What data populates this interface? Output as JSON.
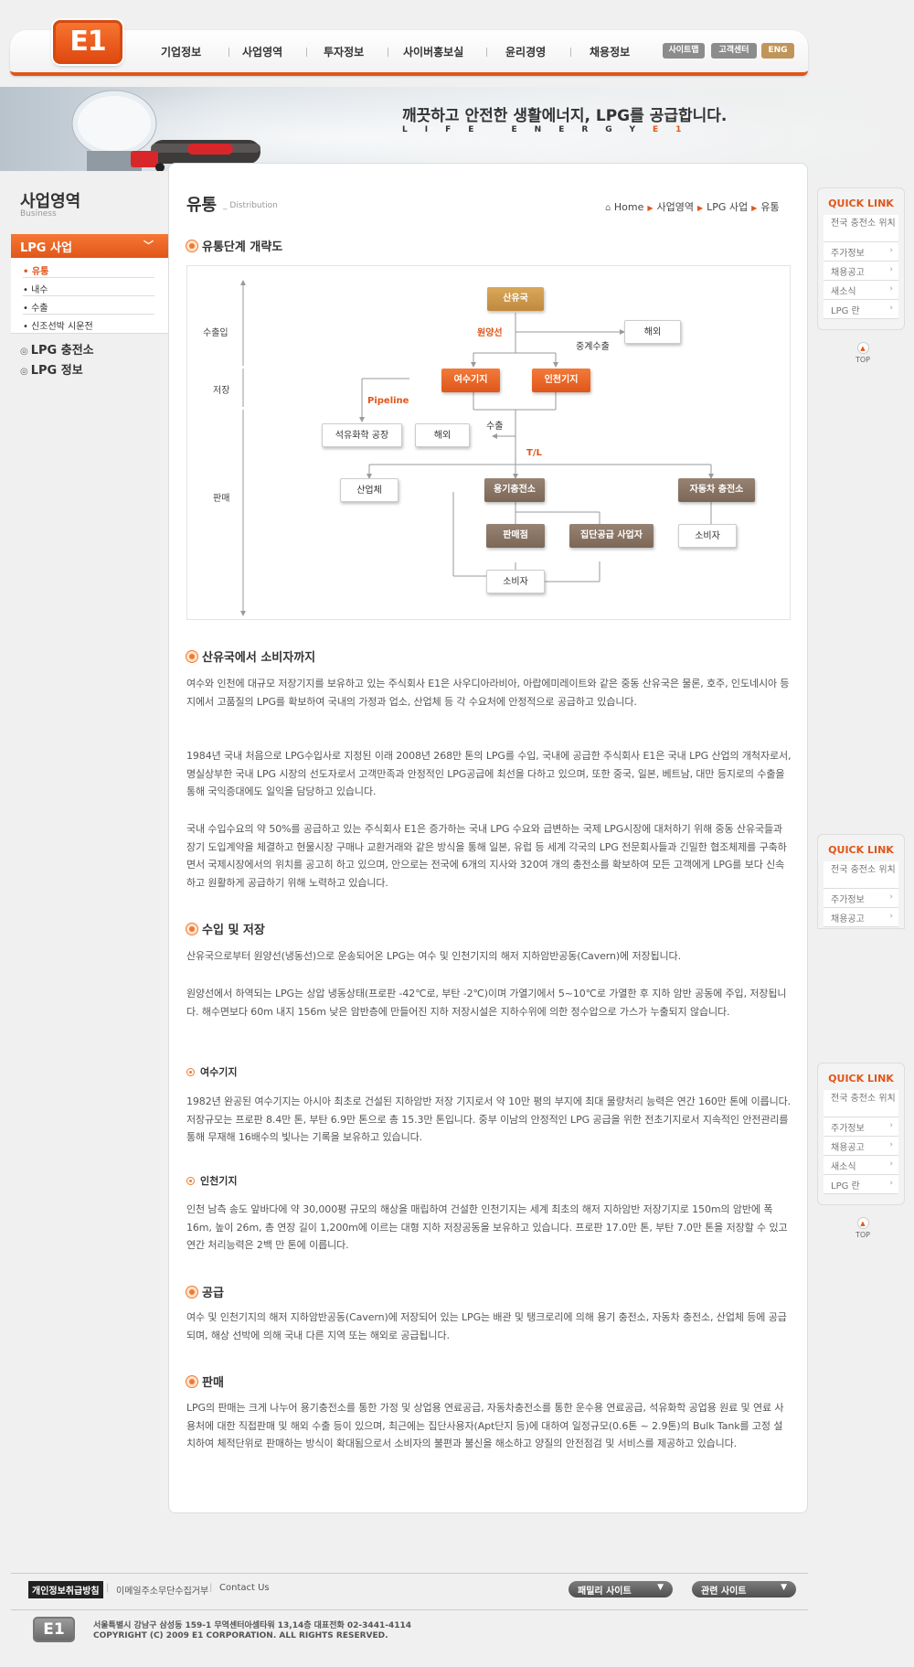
{
  "brand": {
    "logo": "E1",
    "accent": "#e0561a"
  },
  "gnb": {
    "items": [
      "기업정보",
      "사업영역",
      "투자정보",
      "사이버홍보실",
      "윤리경영",
      "채용정보"
    ],
    "util": [
      "사이트맵",
      "고객센터",
      "ENG"
    ]
  },
  "visual": {
    "slogan": "깨끗하고 안전한 생활에너지, LPG를 공급합니다.",
    "sub": "LIFE ENERGY",
    "sub_brand": "E1"
  },
  "lnb": {
    "title": "사업영역",
    "subtitle": "Business",
    "active": "LPG 사업",
    "chevron": "chevron-down-icon",
    "sub_items": [
      "유통",
      "내수",
      "수출",
      "신조선박 시운전"
    ],
    "main_items": [
      "LPG 충전소",
      "LPG 정보"
    ]
  },
  "page": {
    "title": "유통",
    "title_en": "_ Distribution",
    "breadcrumb": [
      "Home",
      "사업영역",
      "LPG 사업",
      "유통"
    ]
  },
  "diagram": {
    "title": "유통단계 개략도",
    "stages": [
      "수출입",
      "저장",
      "판매"
    ],
    "nodes": {
      "origin": "산유국",
      "overseas1": "해외",
      "yeosu": "여수기지",
      "incheon": "인천기지",
      "petro": "석유화학 공장",
      "overseas2": "해외",
      "industry": "산업체",
      "cylinder": "용기충전소",
      "auto": "자동차 충전소",
      "dealer": "판매점",
      "group": "집단공급 사업자",
      "consumer1": "소비자",
      "consumer2": "소비자"
    },
    "labels": {
      "ocean": "원양선",
      "relay": "중계수출",
      "pipeline": "Pipeline",
      "export": "수출",
      "tl": "T/L"
    }
  },
  "sections": [
    {
      "title": "산유국에서 소비자까지",
      "paras": [
        "여수와 인천에 대규모 저장기지를 보유하고 있는 주식회사 E1은 사우디아라비아, 아랍에미레이트와 같은 중동 산유국은 물론, 호주, 인도네시아 등지에서 고품질의 LPG를 확보하여 국내의 가정과 업소, 산업체 등 각 수요처에 안정적으로 공급하고 있습니다.",
        "1984년 국내 처음으로 LPG수입사로 지정된 이래 2008년 268만 톤의 LPG를 수입, 국내에 공급한 주식회사 E1은 국내 LPG 산업의 개척자로서, 명실상부한 국내 LPG 시장의 선도자로서 고객만족과 안정적인 LPG공급에 최선을 다하고 있으며, 또한 중국, 일본, 베트남, 대만 등지로의 수출을 통해 국익증대에도 일익을 담당하고 있습니다.",
        "국내 수입수요의 약 50%를 공급하고 있는 주식회사 E1은 증가하는 국내 LPG 수요와 급변하는 국제 LPG시장에 대처하기 위해 중동 산유국들과 장기 도입계약을 체결하고 현물시장 구매나 교환거래와 같은 방식을 통해 일본, 유럽 등 세계 각국의 LPG 전문회사들과 긴밀한 협조체제를 구축하면서 국제시장에서의 위치를 공고히 하고 있으며, 안으로는 전국에 6개의 지사와 320여 개의 충전소를 확보하여 모든 고객에게 LPG를 보다 신속하고 원활하게 공급하기 위해 노력하고 있습니다."
      ]
    },
    {
      "title": "수입 및 저장",
      "paras": [
        "산유국으로부터 원양선(냉동선)으로 운송되어온 LPG는 여수 및 인천기지의 해저 지하암반공동(Cavern)에 저장됩니다.",
        "원양선에서 하역되는 LPG는 상압 냉동상태(프로판 -42℃로, 부탄 -2℃)이며 가열기에서 5~10℃로 가열한 후 지하 암반 공동에 주입, 저장됩니다. 해수면보다 60m 내지 156m 낮은 암반층에 만들어진 지하 저장시설은 지하수위에 의한 정수압으로 가스가 누출되지 않습니다."
      ]
    },
    {
      "title": "여수기지",
      "paras": [
        "1982년 완공된 여수기지는 아시아 최초로 건설된 지하암반 저장 기지로서 약 10만 평의 부지에 최대 물량처리 능력은 연간 160만 톤에 이릅니다. 저장규모는 프로판 8.4만 톤, 부탄 6.9만 톤으로 총 15.3만 톤입니다. 중부 이남의 안정적인 LPG 공급을 위한 전초기지로서 지속적인 안전관리를 통해 무재해 16배수의 빛나는 기록을 보유하고 있습니다."
      ]
    },
    {
      "title": "인천기지",
      "paras": [
        "인천 남측 송도 앞바다에 약 30,000평 규모의 해상을 매립하여 건설한 인천기지는 세계 최초의 해저 지하암반 저장기지로 150m의 암반에 폭 16m, 높이 26m, 총 연장 길이 1,200m에 이르는 대형 지하 저장공동을 보유하고 있습니다. 프로판 17.0만 톤, 부탄 7.0만 톤을 저장할 수 있고 연간 처리능력은 2백 만 톤에 이릅니다."
      ]
    },
    {
      "title": "공급",
      "paras": [
        "여수 및 인천기지의 해저 지하암반공동(Cavern)에 저장되어 있는 LPG는 배관 및 탱크로리에 의해 용기 충전소, 자동차 충전소, 산업체 등에 공급되며, 해상 선박에 의해 국내 다른 지역 또는 해외로 공급됩니다."
      ]
    },
    {
      "title": "판매",
      "paras": [
        "LPG의 판매는 크게 나누어 용기충전소를 통한 가정 및 상업용 연료공급, 자동차충전소를 통한 운수용 연료공급, 석유화학 공업용 원료 및 연료 사용처에 대한 직접판매 및 해외 수출 등이 있으며, 최근에는 집단사용자(Apt단지 등)에 대하여 일정규모(0.6톤 ~ 2.9톤)의 Bulk Tank를 고정 설치하여 체적단위로 판매하는 방식이 확대됨으로서 소비자의 불편과 불신을 해소하고 양질의 안전점검 및 서비스를 제공하고 있습니다."
      ]
    }
  ],
  "quick": {
    "title": "QUICK LINK",
    "items": [
      "전국 충전소 위치",
      "주가정보",
      "채용공고",
      "새소식",
      "LPG 란"
    ],
    "top": "TOP"
  },
  "footer": {
    "privacy": "개인정보취급방침",
    "email": "이메일주소무단수집거부",
    "contact": "Contact Us",
    "family": "패밀리 사이트",
    "related": "관련 사이트",
    "address": "서울특별시 강남구 삼성동 159-1 무역센터아셈타워 13,14층  대표전화 02-3441-4114",
    "copyright": "COPYRIGHT (C) 2009  E1 CORPORATION. ALL RIGHTS RESERVED.",
    "logo": "E1"
  }
}
